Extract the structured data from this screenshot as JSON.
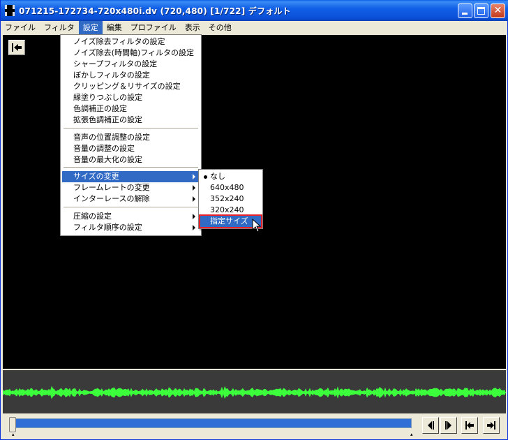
{
  "window": {
    "title": "071215-172734-720x480i.dv (720,480) [1/722] デフォルト",
    "minimize_label": "_",
    "close_label": "✕"
  },
  "menubar": {
    "items": [
      "ファイル",
      "フィルタ",
      "設定",
      "編集",
      "プロファイル",
      "表示",
      "その他"
    ],
    "active_index": 2
  },
  "settings_menu": {
    "groups": [
      [
        "ノイズ除去フィルタの設定",
        "ノイズ除去(時間軸)フィルタの設定",
        "シャープフィルタの設定",
        "ぼかしフィルタの設定",
        "クリッピング＆リサイズの設定",
        "縁塗りつぶしの設定",
        "色調補正の設定",
        "拡張色調補正の設定"
      ],
      [
        "音声の位置調整の設定",
        "音量の調整の設定",
        "音量の最大化の設定"
      ],
      [
        "サイズの変更",
        "フレームレートの変更",
        "インターレースの解除"
      ],
      [
        "圧縮の設定",
        "フィルタ順序の設定"
      ]
    ],
    "items": {
      "noise": "ノイズ除去フィルタの設定",
      "noise_time": "ノイズ除去(時間軸)フィルタの設定",
      "sharp": "シャープフィルタの設定",
      "blur": "ぼかしフィルタの設定",
      "clip": "クリッピング＆リサイズの設定",
      "border": "縁塗りつぶしの設定",
      "color": "色調補正の設定",
      "ext_color": "拡張色調補正の設定",
      "audio_pos": "音声の位置調整の設定",
      "volume": "音量の調整の設定",
      "volume_max": "音量の最大化の設定",
      "resize": "サイズの変更",
      "framerate": "フレームレートの変更",
      "deinterlace": "インターレースの解除",
      "compress": "圧縮の設定",
      "filter_order": "フィルタ順序の設定"
    },
    "highlighted": "サイズの変更"
  },
  "size_submenu": {
    "none": "なし",
    "s640": "640x480",
    "s352": "352x240",
    "s320": "320x240",
    "custom": "指定サイズ",
    "checked": "なし",
    "highlighted": "指定サイズ"
  },
  "seek": {
    "progress": 0.0
  },
  "colors": {
    "menu_highlight": "#316ac5",
    "waveform": "#3cff3c",
    "seek_fill": "#2f6fd6",
    "highlight_outline": "#e8202a"
  },
  "icons": [
    "go-to-start-icon",
    "prev-frame-icon",
    "next-frame-icon",
    "prev-keyframe-icon",
    "next-keyframe-icon",
    "arrow-cursor-icon"
  ]
}
